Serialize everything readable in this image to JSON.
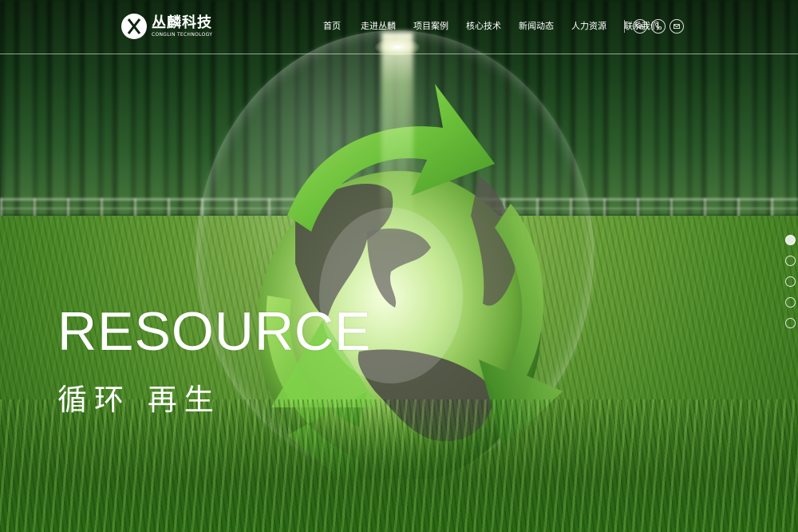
{
  "brand": {
    "name_cn": "丛麟科技",
    "name_en": "CONGLIN TECHNOLOGY"
  },
  "nav": {
    "items": [
      {
        "label": "首页"
      },
      {
        "label": "走进丛麟"
      },
      {
        "label": "项目案例"
      },
      {
        "label": "核心技术"
      },
      {
        "label": "新闻动态"
      },
      {
        "label": "人力资源"
      },
      {
        "label": "联系我们"
      }
    ]
  },
  "header_icons": [
    "wechat-icon",
    "phone-icon",
    "mail-icon"
  ],
  "hero": {
    "title_en": "RESOURCE",
    "title_cn": "循环 再生"
  },
  "slider": {
    "total": 5,
    "active": 1
  },
  "colors": {
    "text": "#ffffff",
    "accent_green": "#6fbf3a"
  }
}
